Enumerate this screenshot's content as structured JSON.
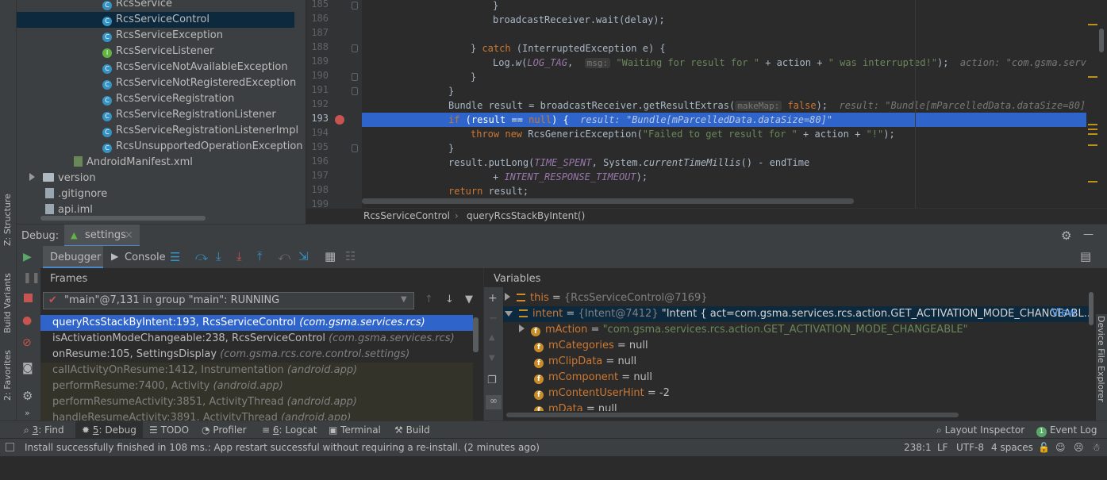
{
  "left_strip": {
    "tab_structure": "Z: Structure",
    "tab_build_variants": "Build Variants",
    "tab_favorites": "2: Favorites"
  },
  "tree": {
    "items": [
      {
        "label": "RcsService",
        "icon": "class-icon"
      },
      {
        "label": "RcsServiceControl",
        "icon": "class-icon",
        "selected": true
      },
      {
        "label": "RcsServiceException",
        "icon": "class-icon"
      },
      {
        "label": "RcsServiceListener",
        "icon": "interface-icon"
      },
      {
        "label": "RcsServiceNotAvailableException",
        "icon": "class-icon"
      },
      {
        "label": "RcsServiceNotRegisteredException",
        "icon": "class-icon"
      },
      {
        "label": "RcsServiceRegistration",
        "icon": "class-icon"
      },
      {
        "label": "RcsServiceRegistrationListener",
        "icon": "class-icon"
      },
      {
        "label": "RcsServiceRegistrationListenerImpl",
        "icon": "class-icon"
      },
      {
        "label": "RcsUnsupportedOperationException",
        "icon": "class-icon"
      },
      {
        "label": "AndroidManifest.xml",
        "icon": "manifest-icon"
      },
      {
        "label": "version",
        "icon": "folder-icon"
      },
      {
        "label": ".gitignore",
        "icon": "file-icon"
      },
      {
        "label": "api.iml",
        "icon": "file-icon"
      }
    ]
  },
  "editor": {
    "line_numbers": [
      "185",
      "186",
      "187",
      "188",
      "189",
      "190",
      "191",
      "192",
      "193",
      "194",
      "195",
      "196",
      "197",
      "198",
      "199"
    ],
    "l185": "}",
    "l186": "broadcastReceiver.wait(delay);",
    "l188_a": "} ",
    "l188_kw": "catch",
    "l188_b": " (InterruptedException e) {",
    "l189_a": "Log.",
    "l189_w": "w",
    "l189_b": "(",
    "l189_tag": "LOG_TAG",
    "l189_c": ",  ",
    "l189_msg": "msg:",
    "l189_s1": " \"Waiting for result for \"",
    "l189_d": " + action + ",
    "l189_s2": "\" was interrupted!\"",
    "l189_e": ");  ",
    "l189_hint": "action: \"com.gsma.services.rcs.",
    "l190": "}",
    "l191": "}",
    "l192_a": "Bundle result = broadcastReceiver.getResultExtras(",
    "l192_param": "makeMap:",
    "l192_kw": " false",
    "l192_b": ");  ",
    "l192_hint": "result: \"Bundle[mParcelledData.dataSize=80]\"   br",
    "l193_kw": "if",
    "l193_a": " (result == ",
    "l193_null": "null",
    "l193_b": ") {  ",
    "l193_hint": "result: \"Bundle[mParcelledData.dataSize=80]\"",
    "l194_kw": "throw new",
    "l194_a": " RcsGenericException(",
    "l194_s": "\"Failed to get result for \"",
    "l194_b": " + action + ",
    "l194_s2": "\"!\"",
    "l194_c": ");",
    "l195": "}",
    "l196_a": "result.putLong(",
    "l196_c1": "TIME_SPENT",
    "l196_b": ", System.",
    "l196_m": "currentTimeMillis",
    "l196_c": "() - endTime",
    "l197_a": "+ ",
    "l197_c": "INTENT_RESPONSE_TIMEOUT",
    "l197_b": ");",
    "l198_kw": "return",
    "l198_a": " result;"
  },
  "breadcrumb": {
    "class": "RcsServiceControl",
    "method": "queryRcsStackByIntent()"
  },
  "debug": {
    "label": "Debug:",
    "session_tab": "settings",
    "tab_debugger": "Debugger",
    "tab_console": "Console",
    "frames_title": "Frames",
    "variables_title": "Variables",
    "thread": "\"main\"@7,131 in group \"main\": RUNNING",
    "frames": [
      {
        "method": "queryRcsStackByIntent:193, RcsServiceControl",
        "pkg": "(com.gsma.services.rcs)",
        "selected": true,
        "dim": false
      },
      {
        "method": "isActivationModeChangeable:238, RcsServiceControl",
        "pkg": "(com.gsma.services.rcs)",
        "selected": false,
        "dim": false
      },
      {
        "method": "onResume:105, SettingsDisplay",
        "pkg": "(com.gsma.rcs.core.control.settings)",
        "selected": false,
        "dim": false
      },
      {
        "method": "callActivityOnResume:1412, Instrumentation",
        "pkg": "(android.app)",
        "selected": false,
        "dim": true
      },
      {
        "method": "performResume:7400, Activity",
        "pkg": "(android.app)",
        "selected": false,
        "dim": true
      },
      {
        "method": "performResumeActivity:3851, ActivityThread",
        "pkg": "(android.app)",
        "selected": false,
        "dim": true
      },
      {
        "method": "handleResumeActivity:3891, ActivityThread",
        "pkg": "(android.app)",
        "selected": false,
        "dim": true
      }
    ],
    "variables": [
      {
        "name": "this",
        "eq": " = ",
        "type": "{RcsServiceControl@7169}",
        "value": "",
        "expand": "collapsed",
        "icon": "list-icon",
        "indent": 0
      },
      {
        "name": "intent",
        "eq": " = ",
        "type": "{Intent@7412}",
        "value": " \"Intent { act=com.gsma.services.rcs.action.GET_ACTIVATION_MODE_CHANGEABL...",
        "expand": "expanded",
        "icon": "list-icon",
        "indent": 0,
        "selected": true,
        "link": "View"
      },
      {
        "name": "mAction",
        "eq": " = ",
        "type": "",
        "value": "\"com.gsma.services.rcs.action.GET_ACTIVATION_MODE_CHANGEABLE\"",
        "expand": "collapsed",
        "icon": "field-icon",
        "indent": 1,
        "string": true
      },
      {
        "name": "mCategories",
        "eq": " = ",
        "type": "",
        "value": "null",
        "expand": "none",
        "icon": "field-icon",
        "indent": 1
      },
      {
        "name": "mClipData",
        "eq": " = ",
        "type": "",
        "value": "null",
        "expand": "none",
        "icon": "field-icon",
        "indent": 1
      },
      {
        "name": "mComponent",
        "eq": " = ",
        "type": "",
        "value": "null",
        "expand": "none",
        "icon": "field-icon",
        "indent": 1
      },
      {
        "name": "mContentUserHint",
        "eq": " = ",
        "type": "",
        "value": "-2",
        "expand": "none",
        "icon": "field-icon",
        "indent": 1
      },
      {
        "name": "mData",
        "eq": " = ",
        "type": "",
        "value": "null",
        "expand": "none",
        "icon": "field-icon",
        "indent": 1
      }
    ]
  },
  "bottom_tabs": {
    "find_num": "3",
    "find": ": Find",
    "debug_num": "5",
    "debug": ": Debug",
    "todo": "TODO",
    "profiler": "Profiler",
    "logcat_num": "6",
    "logcat": ": Logcat",
    "terminal": "Terminal",
    "build": "Build",
    "layout_inspector": "Layout Inspector",
    "event_log_num": "1",
    "event_log": "Event Log"
  },
  "status": {
    "message": "Install successfully finished in 108 ms.: App restart successful without requiring a re-install. (2 minutes ago)",
    "position": "238:1",
    "line_sep": "LF",
    "encoding": "UTF-8",
    "indent": "4 spaces"
  },
  "right_strip": {
    "device_explorer": "Device File Explorer"
  },
  "colors": {
    "selection": "#2f65ca",
    "keyword": "#cc7832",
    "string": "#6a8759",
    "constant": "#9876aa"
  }
}
